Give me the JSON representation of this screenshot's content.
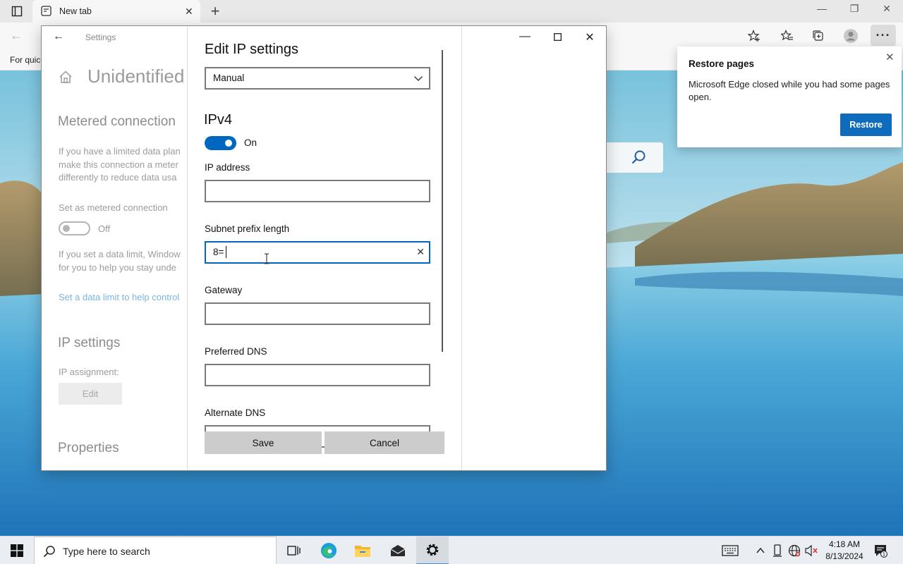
{
  "browser": {
    "tab_title": "New tab",
    "favorites_bar_text": "For quic",
    "restore_popup": {
      "title": "Restore pages",
      "message": "Microsoft Edge closed while you had some pages open.",
      "button": "Restore"
    }
  },
  "settings_window": {
    "app_title": "Settings",
    "page_title": "Unidentified",
    "metered": {
      "heading": "Metered connection",
      "desc_lines": [
        "If you have a limited data plan",
        "make this connection a meter",
        "differently to reduce data usa"
      ],
      "toggle_label": "Set as metered connection",
      "toggle_state": "Off",
      "data_limit_lines": [
        "If you set a data limit, Window",
        "for you to help you stay unde"
      ],
      "data_limit_link": "Set a data limit to help control"
    },
    "ip_settings": {
      "heading": "IP settings",
      "assignment_label": "IP assignment:",
      "edit_button": "Edit"
    },
    "properties_heading": "Properties"
  },
  "dialog": {
    "title": "Edit IP settings",
    "mode": "Manual",
    "ipv4_heading": "IPv4",
    "ipv4_toggle": "On",
    "fields": {
      "ip_address": {
        "label": "IP address",
        "value": ""
      },
      "subnet_prefix": {
        "label": "Subnet prefix length",
        "value": "8="
      },
      "gateway": {
        "label": "Gateway",
        "value": ""
      },
      "preferred_dns": {
        "label": "Preferred DNS",
        "value": ""
      },
      "alternate_dns": {
        "label": "Alternate DNS",
        "value": ""
      }
    },
    "save_button": "Save",
    "cancel_button": "Cancel"
  },
  "taskbar": {
    "search_placeholder": "Type here to search",
    "time": "4:18 AM",
    "date": "8/13/2024",
    "notification_count": "1"
  },
  "colors": {
    "accent": "#0067c0",
    "restore_button": "#0f6cbd",
    "link": "#7bb5e6"
  }
}
